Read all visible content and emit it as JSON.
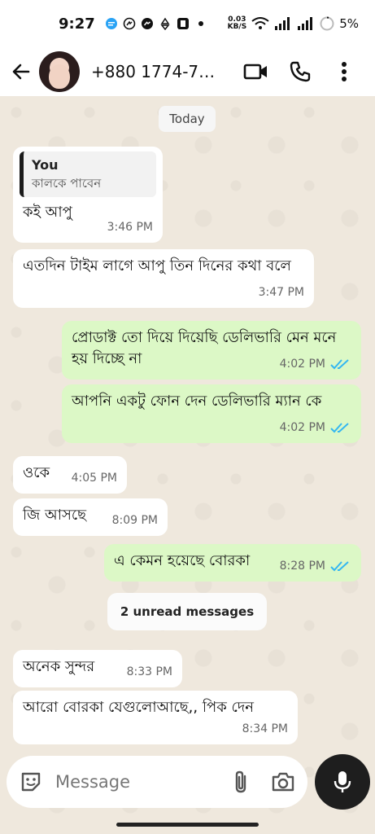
{
  "status": {
    "time": "9:27",
    "net_speed_value": "0.03",
    "net_speed_unit": "KB/S",
    "battery": "5%"
  },
  "header": {
    "contact_name": "+880 1774-70..."
  },
  "chat": {
    "date_label": "Today",
    "unread_label": "2 unread messages",
    "messages": [
      {
        "dir": "in",
        "quote_author": "You",
        "quote_text": "কালকে পাবেন",
        "text": "কই আপু",
        "time": "3:46 PM"
      },
      {
        "dir": "in",
        "text": "এতদিন টাইম লাগে আপু তিন দিনের কথা বলে",
        "time": "3:47 PM"
      },
      {
        "dir": "out",
        "text": "প্রোডাক্ট তো দিয়ে দিয়েছি ডেলিভারি মেন মনে হয় দিচ্ছে না",
        "time": "4:02 PM"
      },
      {
        "dir": "out",
        "text": "আপনি একটু ফোন দেন ডেলিভারি ম্যান কে",
        "time": "4:02 PM"
      },
      {
        "dir": "in",
        "text": "ওকে",
        "time": "4:05 PM"
      },
      {
        "dir": "in",
        "text": "জি আসছে",
        "time": "8:09 PM"
      },
      {
        "dir": "out",
        "text": "এ কেমন হয়েছে বোরকা",
        "time": "8:28 PM"
      },
      {
        "dir": "in",
        "text": "অনেক সুন্দর",
        "time": "8:33 PM"
      },
      {
        "dir": "in",
        "text": "আরো বোরকা যেগুলোআছে,, পিক দেন",
        "time": "8:34 PM"
      }
    ]
  },
  "composer": {
    "placeholder": "Message"
  },
  "colors": {
    "incoming": "#ffffff",
    "outgoing": "#dcf8c6",
    "read_ticks": "#34b7f1",
    "wallpaper": "#efe8dd"
  }
}
